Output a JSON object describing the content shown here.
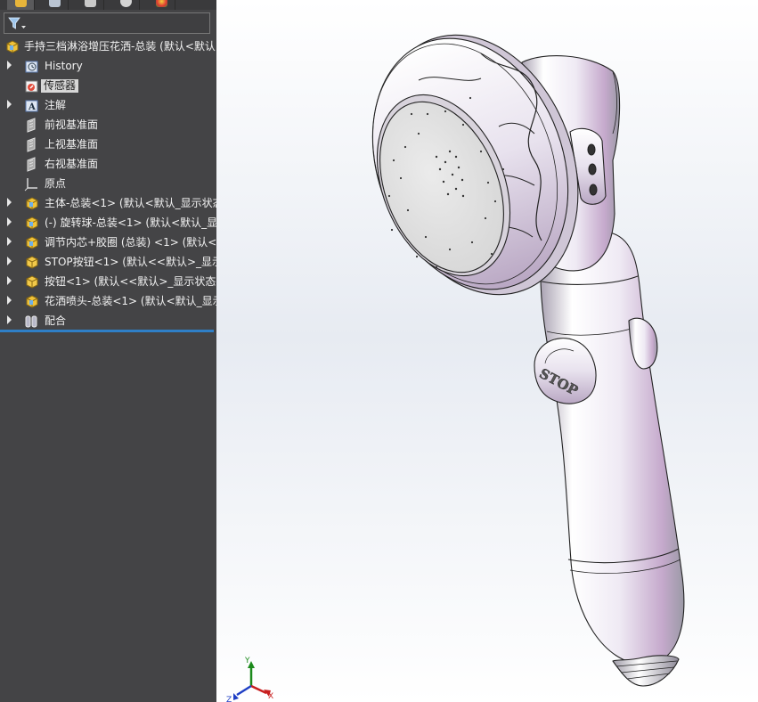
{
  "tree": {
    "root": {
      "label": "手持三档淋浴增压花洒-总装 (默认<默认",
      "icon": "assembly-icon"
    },
    "items": [
      {
        "label": "History",
        "icon": "history-icon",
        "expandable": true
      },
      {
        "label": "传感器",
        "icon": "sensor-icon",
        "expandable": false,
        "selected": true
      },
      {
        "label": "注解",
        "icon": "annotation-icon",
        "expandable": true
      },
      {
        "label": "前视基准面",
        "icon": "plane-icon",
        "expandable": false
      },
      {
        "label": "上视基准面",
        "icon": "plane-icon",
        "expandable": false
      },
      {
        "label": "右视基准面",
        "icon": "plane-icon",
        "expandable": false
      },
      {
        "label": "原点",
        "icon": "origin-icon",
        "expandable": false
      },
      {
        "label": "主体-总装<1> (默认<默认_显示状态",
        "icon": "subassembly-icon",
        "expandable": true
      },
      {
        "label": "(-) 旋转球-总装<1> (默认<默认_显",
        "icon": "subassembly-icon",
        "expandable": true
      },
      {
        "label": "调节内芯+胶圈 (总装) <1> (默认<",
        "icon": "subassembly-icon",
        "expandable": true
      },
      {
        "label": "STOP按钮<1> (默认<<默认>_显示",
        "icon": "part-icon",
        "expandable": true
      },
      {
        "label": "按钮<1> (默认<<默认>_显示状态",
        "icon": "part-icon",
        "expandable": true
      },
      {
        "label": "花洒喷头-总装<1> (默认<默认_显示",
        "icon": "subassembly-icon",
        "expandable": true
      },
      {
        "label": "配合",
        "icon": "mates-icon",
        "expandable": true
      }
    ]
  },
  "model": {
    "button_text": "STOP"
  },
  "triad": {
    "x": "X",
    "y": "Y",
    "z": "Z"
  },
  "colors": {
    "panel": "#444446",
    "accent": "#2f7fc7",
    "text": "#f2f2f2"
  }
}
